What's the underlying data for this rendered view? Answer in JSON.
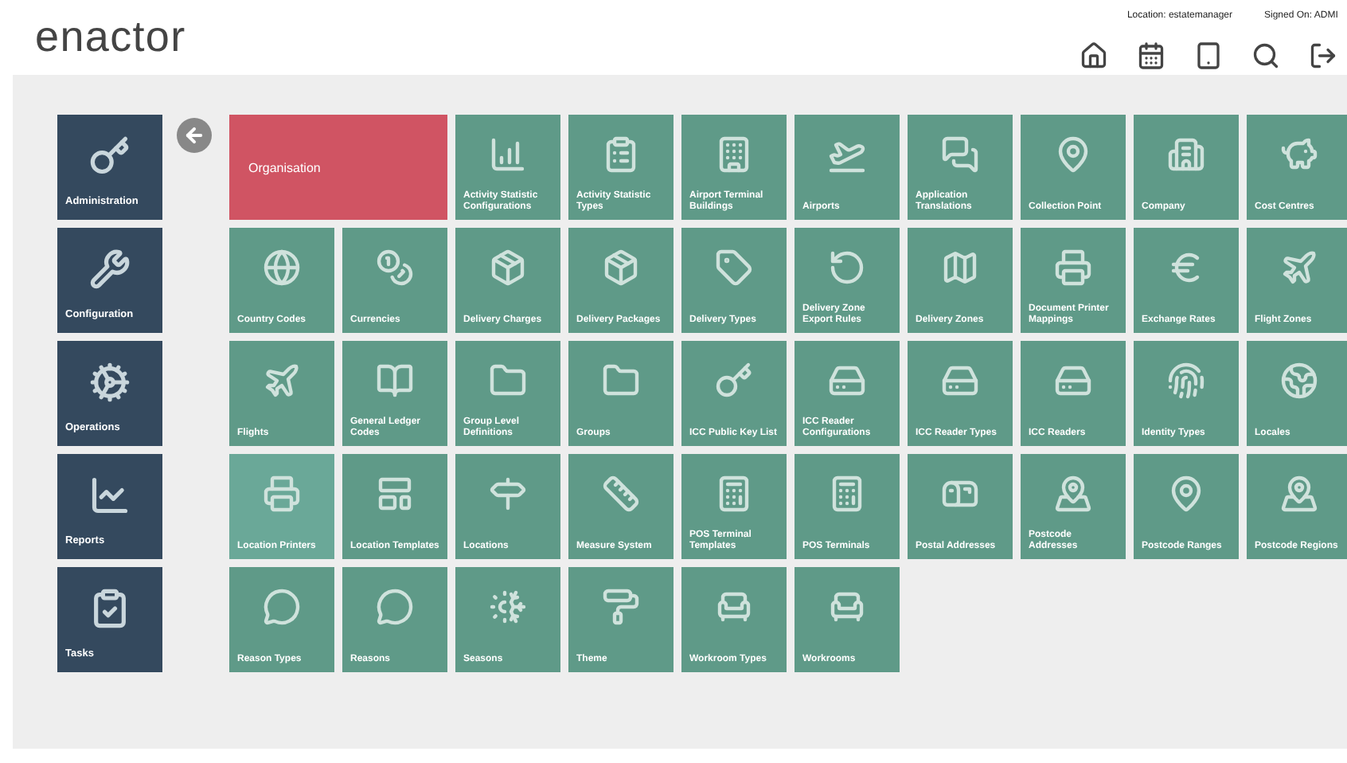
{
  "header": {
    "logo": "enactor",
    "location": "Location: estatemanager",
    "signed_on": "Signed On: ADMI"
  },
  "sidebar": {
    "items": [
      {
        "label": "Administration"
      },
      {
        "label": "Configuration"
      },
      {
        "label": "Operations"
      },
      {
        "label": "Reports"
      },
      {
        "label": "Tasks"
      }
    ]
  },
  "tiles": [
    {
      "label": "Organisation",
      "kind": "feature",
      "highlighted": false
    },
    {
      "label": "Activity Statistic Configurations",
      "kind": "normal",
      "highlighted": false
    },
    {
      "label": "Activity Statistic Types",
      "kind": "normal",
      "highlighted": false
    },
    {
      "label": "Airport Terminal Buildings",
      "kind": "normal",
      "highlighted": false
    },
    {
      "label": "Airports",
      "kind": "normal",
      "highlighted": false
    },
    {
      "label": "Application Translations",
      "kind": "normal",
      "highlighted": false
    },
    {
      "label": "Collection Point",
      "kind": "normal",
      "highlighted": false
    },
    {
      "label": "Company",
      "kind": "normal",
      "highlighted": false
    },
    {
      "label": "Cost Centres",
      "kind": "normal",
      "highlighted": false
    },
    {
      "label": "Country Codes",
      "kind": "normal",
      "highlighted": false
    },
    {
      "label": "Currencies",
      "kind": "normal",
      "highlighted": false
    },
    {
      "label": "Delivery Charges",
      "kind": "normal",
      "highlighted": false
    },
    {
      "label": "Delivery Packages",
      "kind": "normal",
      "highlighted": false
    },
    {
      "label": "Delivery Types",
      "kind": "normal",
      "highlighted": false
    },
    {
      "label": "Delivery Zone Export Rules",
      "kind": "normal",
      "highlighted": false
    },
    {
      "label": "Delivery Zones",
      "kind": "normal",
      "highlighted": false
    },
    {
      "label": "Document Printer Mappings",
      "kind": "normal",
      "highlighted": false
    },
    {
      "label": "Exchange Rates",
      "kind": "normal",
      "highlighted": false
    },
    {
      "label": "Flight Zones",
      "kind": "normal",
      "highlighted": false
    },
    {
      "label": "Flights",
      "kind": "normal",
      "highlighted": false
    },
    {
      "label": "General Ledger Codes",
      "kind": "normal",
      "highlighted": false
    },
    {
      "label": "Group Level Definitions",
      "kind": "normal",
      "highlighted": false
    },
    {
      "label": "Groups",
      "kind": "normal",
      "highlighted": false
    },
    {
      "label": "ICC Public Key List",
      "kind": "normal",
      "highlighted": false
    },
    {
      "label": "ICC Reader Configurations",
      "kind": "normal",
      "highlighted": false
    },
    {
      "label": "ICC Reader Types",
      "kind": "normal",
      "highlighted": false
    },
    {
      "label": "ICC Readers",
      "kind": "normal",
      "highlighted": false
    },
    {
      "label": "Identity Types",
      "kind": "normal",
      "highlighted": false
    },
    {
      "label": "Locales",
      "kind": "normal",
      "highlighted": false
    },
    {
      "label": "Location Printers",
      "kind": "normal",
      "highlighted": true
    },
    {
      "label": "Location Templates",
      "kind": "normal",
      "highlighted": false
    },
    {
      "label": "Locations",
      "kind": "normal",
      "highlighted": false
    },
    {
      "label": "Measure System",
      "kind": "normal",
      "highlighted": false
    },
    {
      "label": "POS Terminal Templates",
      "kind": "normal",
      "highlighted": false
    },
    {
      "label": "POS Terminals",
      "kind": "normal",
      "highlighted": false
    },
    {
      "label": "Postal Addresses",
      "kind": "normal",
      "highlighted": false
    },
    {
      "label": "Postcode Addresses",
      "kind": "normal",
      "highlighted": false
    },
    {
      "label": "Postcode Ranges",
      "kind": "normal",
      "highlighted": false
    },
    {
      "label": "Postcode Regions",
      "kind": "normal",
      "highlighted": false
    },
    {
      "label": "Reason Types",
      "kind": "normal",
      "highlighted": false
    },
    {
      "label": "Reasons",
      "kind": "normal",
      "highlighted": false
    },
    {
      "label": "Seasons",
      "kind": "normal",
      "highlighted": false
    },
    {
      "label": "Theme",
      "kind": "normal",
      "highlighted": false
    },
    {
      "label": "Workroom Types",
      "kind": "normal",
      "highlighted": false
    },
    {
      "label": "Workrooms",
      "kind": "normal",
      "highlighted": false
    }
  ]
}
